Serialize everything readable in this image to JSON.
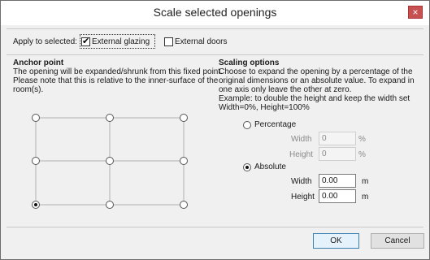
{
  "window": {
    "title": "Scale selected openings",
    "close_glyph": "×"
  },
  "apply": {
    "label": "Apply to selected:",
    "external_glazing": {
      "label": "External glazing",
      "checked": true
    },
    "external_doors": {
      "label": "External doors",
      "checked": false
    }
  },
  "anchor": {
    "title": "Anchor point",
    "line1": "The opening will be expanded/shrunk from this fixed point.",
    "line2": "Please note that this is relative to the inner-surface of the",
    "line3": "room(s).",
    "selected_point": "bottom-left"
  },
  "scaling": {
    "title": "Scaling options",
    "line1": "Choose to expand the opening by a percentage of the",
    "line2": "original dimensions or an absolute value. To expand in",
    "line3": "one axis only leave the other at zero.",
    "line4": "Example: to double the height and keep the width set",
    "line5": "Width=0%, Height=100%",
    "percentage": {
      "label": "Percentage",
      "width_label": "Width",
      "width_value": "0",
      "width_unit": "%",
      "height_label": "Height",
      "height_value": "0",
      "height_unit": "%"
    },
    "absolute": {
      "label": "Absolute",
      "width_label": "Width",
      "width_value": "0.00",
      "width_unit": "m",
      "height_label": "Height",
      "height_value": "0.00",
      "height_unit": "m"
    },
    "selected_mode": "Absolute"
  },
  "buttons": {
    "ok": "OK",
    "cancel": "Cancel"
  }
}
